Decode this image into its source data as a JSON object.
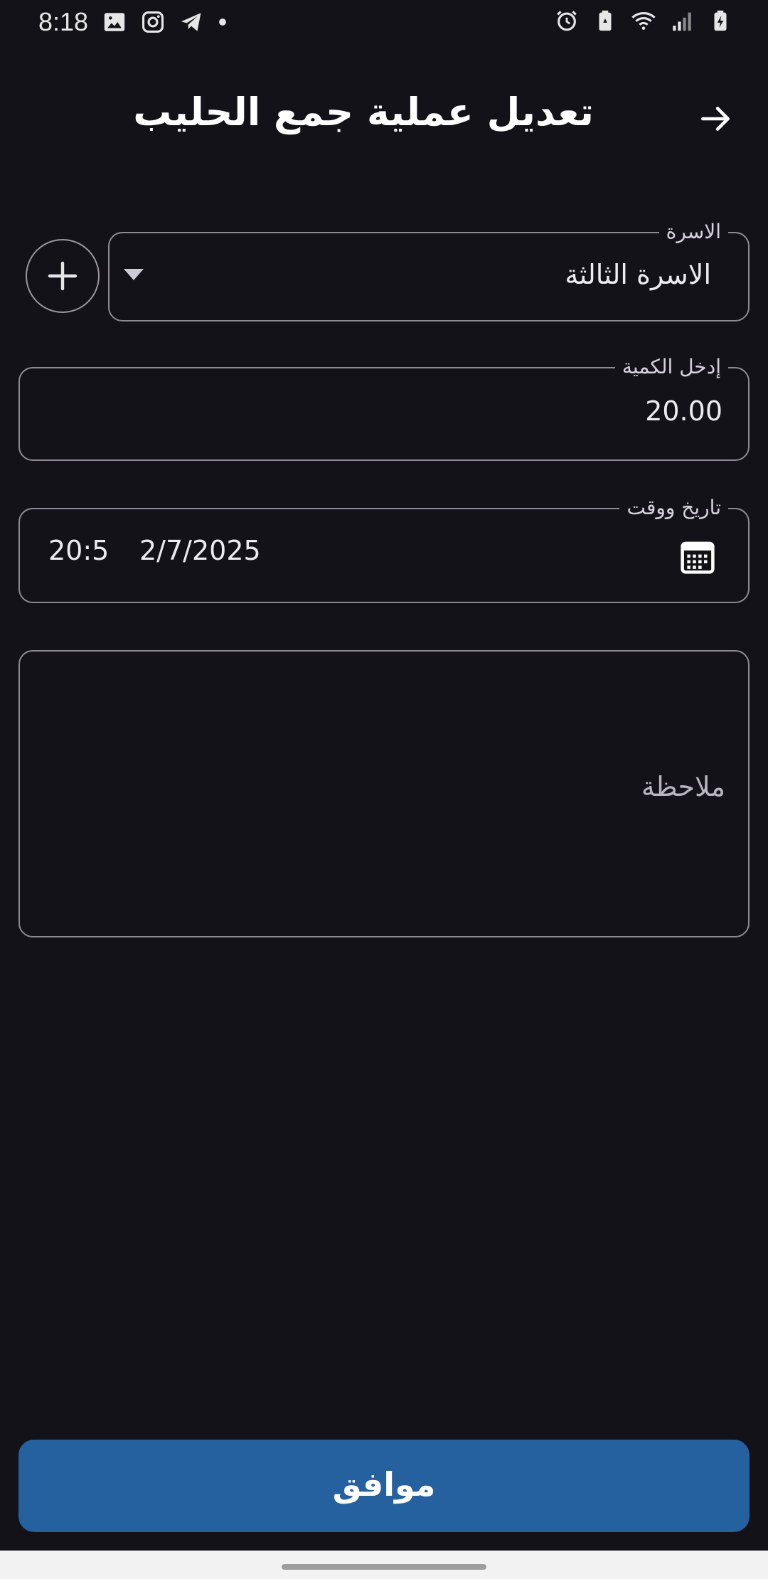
{
  "status_bar": {
    "time": "8:18",
    "left_icons": [
      "image-icon",
      "instagram-icon",
      "telegram-icon",
      "dot-icon"
    ],
    "right_icons": [
      "alarm-icon",
      "battery-saver-icon",
      "wifi-icon",
      "signal-icon",
      "battery-charging-icon"
    ]
  },
  "header": {
    "title": "تعديل عملية جمع الحليب",
    "back_icon": "arrow-right-icon"
  },
  "form": {
    "family": {
      "label": "الاسرة",
      "value": "الاسرة الثالثة"
    },
    "quantity": {
      "label": "إدخل الكمية",
      "value": "20.00"
    },
    "datetime": {
      "label": "تاريخ ووقت",
      "date": "2/7/2025",
      "time": "20:5"
    },
    "note": {
      "placeholder": "ملاحظة"
    }
  },
  "actions": {
    "ok_label": "موافق"
  },
  "colors": {
    "background": "#141219",
    "button": "#25609f",
    "outline": "#8e8a94"
  }
}
